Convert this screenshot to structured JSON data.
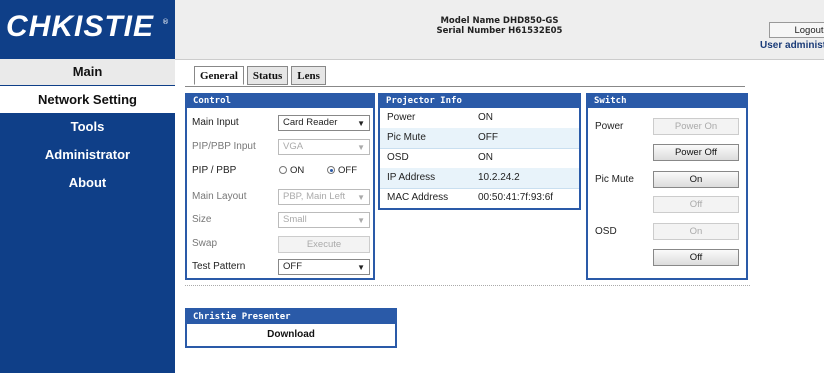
{
  "brand": {
    "logo_text": "CHKISTIE",
    "reg": "®"
  },
  "nav": [
    {
      "label": "Main"
    },
    {
      "label": "Network Setting"
    },
    {
      "label": "Tools"
    },
    {
      "label": "Administrator"
    },
    {
      "label": "About"
    }
  ],
  "header": {
    "model": "Model Name DHD850-GS",
    "serial": "Serial Number H61532E05",
    "logout_label": "Logout",
    "user": "User administrato"
  },
  "tabs": [
    {
      "label": "General",
      "active": true
    },
    {
      "label": "Status",
      "active": false
    },
    {
      "label": "Lens",
      "active": false
    }
  ],
  "control": {
    "title": "Control",
    "main_input": {
      "label": "Main Input",
      "value": "Card Reader"
    },
    "pip_pbp_input": {
      "label": "PIP/PBP Input",
      "value": "VGA"
    },
    "pip_pbp": {
      "label": "PIP / PBP",
      "on_label": "ON",
      "off_label": "OFF",
      "selected": "OFF"
    },
    "main_layout": {
      "label": "Main Layout",
      "value": "PBP, Main Left"
    },
    "size": {
      "label": "Size",
      "value": "Small"
    },
    "swap": {
      "label": "Swap",
      "button": "Execute"
    },
    "test_pattern": {
      "label": "Test Pattern",
      "value": "OFF"
    }
  },
  "projector_info": {
    "title": "Projector Info",
    "rows": [
      {
        "key": "Power",
        "value": "ON"
      },
      {
        "key": "Pic Mute",
        "value": "OFF"
      },
      {
        "key": "OSD",
        "value": "ON"
      },
      {
        "key": "IP Address",
        "value": "10.2.24.2"
      },
      {
        "key": "MAC Address",
        "value": "00:50:41:7f:93:6f"
      }
    ]
  },
  "switch": {
    "title": "Switch",
    "power_label": "Power",
    "power_on": "Power On",
    "power_off": "Power Off",
    "pic_mute_label": "Pic Mute",
    "pic_on": "On",
    "pic_off": "Off",
    "osd_label": "OSD",
    "osd_on": "On",
    "osd_off": "Off"
  },
  "presenter": {
    "title": "Christie Presenter",
    "download": "Download"
  },
  "colors": {
    "brand_blue": "#0f3f88",
    "panel_blue": "#2a5aa8"
  }
}
